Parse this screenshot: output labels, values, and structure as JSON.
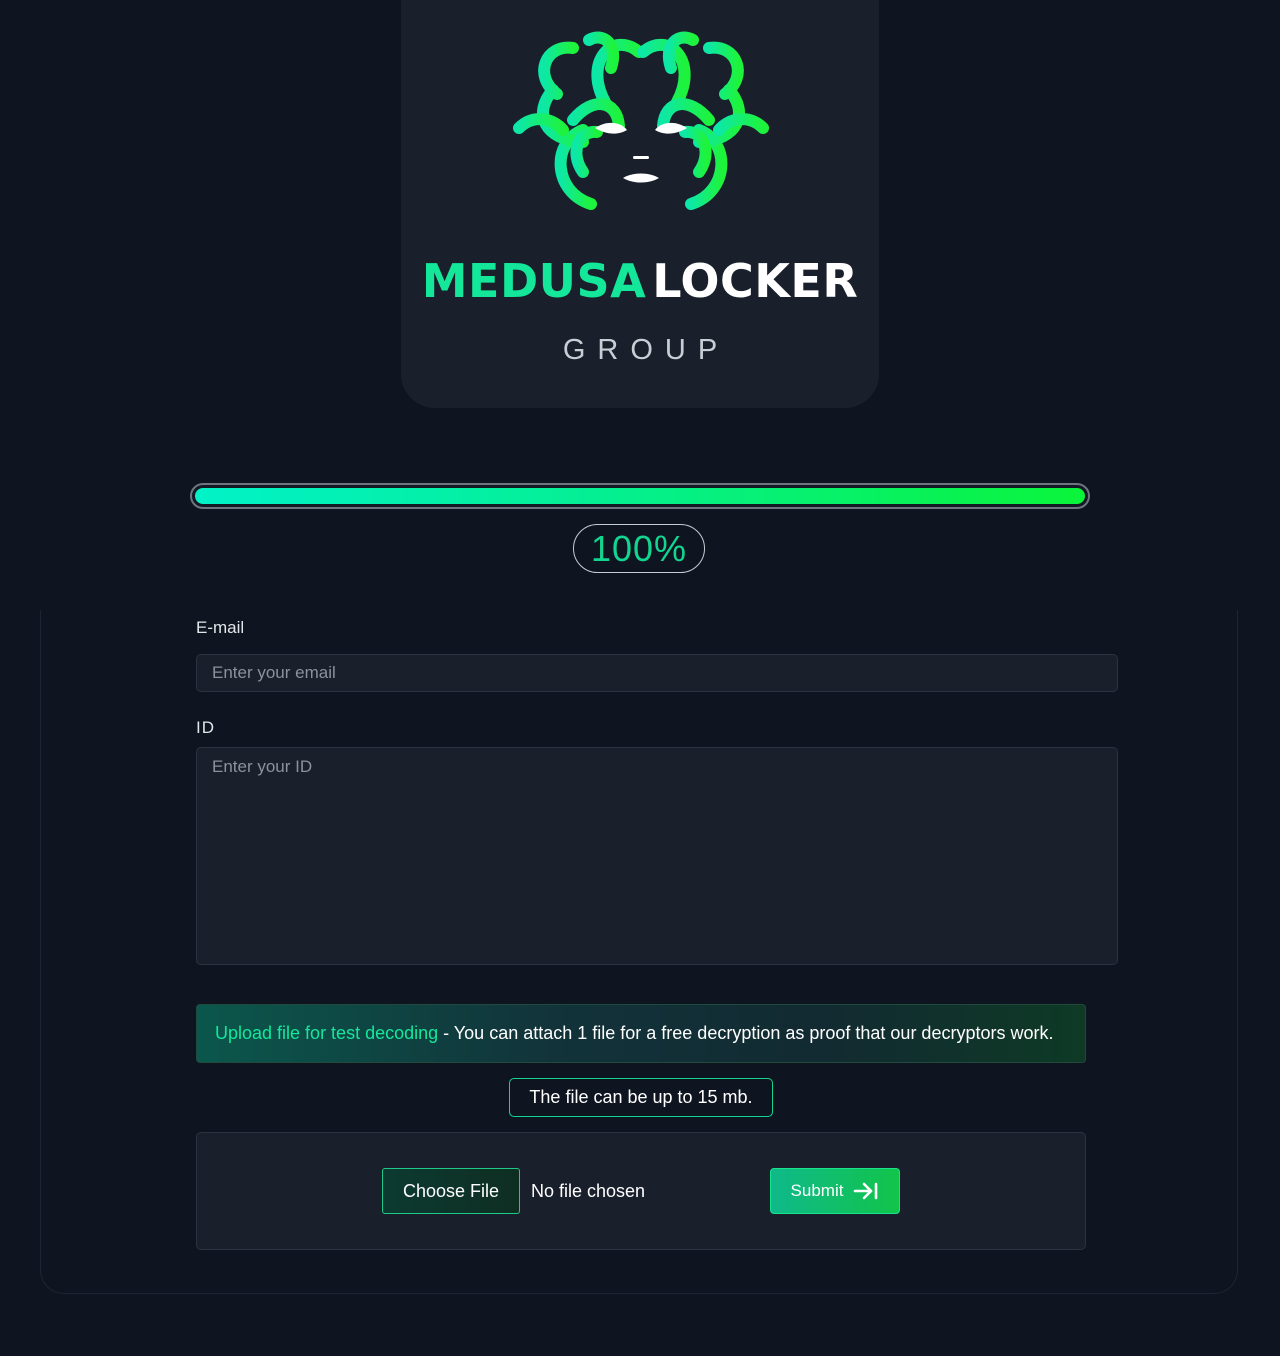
{
  "brand": {
    "word1": "MEDUSA",
    "word2": "LOCKER",
    "subtitle": "GROUP"
  },
  "progress": {
    "value": 100,
    "label": "100%"
  },
  "form": {
    "email_label": "E-mail",
    "email_placeholder": "Enter your email",
    "id_label": "ID",
    "id_placeholder": "Enter your ID",
    "upload_highlight": "Upload file for test decoding",
    "upload_text": " - You can attach 1 file for a free decryption as proof that our decryptors work.",
    "size_note": "The file can be up to 15 mb.",
    "choose_file_label": "Choose File",
    "file_status": "No file chosen",
    "submit_label": "Submit"
  },
  "colors": {
    "accent_teal": "#14e79a",
    "accent_green": "#0af43b",
    "background": "#0f1520",
    "card": "#191f2b"
  },
  "icons": {
    "logo": "medusa-head-icon",
    "submit": "arrow-right-to-bar-icon"
  }
}
